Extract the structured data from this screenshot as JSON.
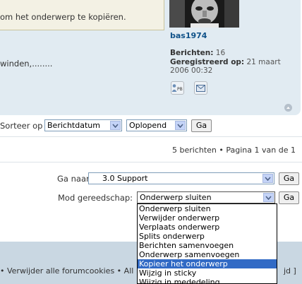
{
  "post": {
    "notice_text": "om het onderwerp te kopiëren.",
    "body_text": "winden,........",
    "author": {
      "username": "bas1974",
      "posts_label": "Berichten:",
      "posts_value": "16",
      "registered_label": "Geregistreerd op:",
      "registered_value_line1": "21 maart",
      "registered_value_line2": "2006 00:32"
    },
    "pm_icon": "pm-icon",
    "email_icon": "email-icon",
    "back_to_top_icon": "back-to-top-icon"
  },
  "sort": {
    "label": "Sorteer op",
    "field_value": "Berichtdatum",
    "order_value": "Oplopend",
    "go_label": "Ga"
  },
  "pagination": {
    "text": "5 berichten • Pagina 1 van de 1"
  },
  "jump": {
    "label": "Ga naar:",
    "value": "3.0 Support",
    "go_label": "Ga"
  },
  "mod": {
    "label": "Mod gereedschap:",
    "value": "Onderwerp sluiten",
    "go_label": "Ga",
    "options": [
      "Onderwerp sluiten",
      "Verwijder onderwerp",
      "Verplaats onderwerp",
      "Splits onderwerp",
      "Berichten samenvoegen",
      "Onderwerp samenvoegen",
      "Kopieer het onderwerp",
      "Wijzig in sticky",
      "Wijzig in mededeling"
    ],
    "selected_option": "Kopieer het onderwerp"
  },
  "footer": {
    "left_text": "• Verwijder alle forumcookies • All",
    "right_text": "jd ]"
  },
  "colors": {
    "panel": "#e1ebf2",
    "link": "#105289",
    "highlight": "#316ac5",
    "footer": "#c9d7e2"
  }
}
